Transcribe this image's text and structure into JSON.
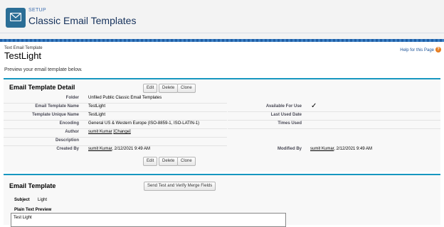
{
  "header": {
    "eyebrow": "SETUP",
    "title": "Classic Email Templates"
  },
  "page": {
    "eyebrow": "Text Email Template",
    "title": "TestLight",
    "help": "Help for this Page",
    "intro": "Preview your email template below."
  },
  "detail": {
    "title": "Email Template Detail",
    "buttons": {
      "edit": "Edit",
      "delete": "Delete",
      "clone": "Clone"
    },
    "folder_label": "Folder",
    "folder_value": "Unfiled Public Classic Email Templates",
    "name_label": "Email Template Name",
    "name_value": "TestLight",
    "available_label": "Available For Use",
    "available_value": "✓",
    "unique_label": "Template Unique Name",
    "unique_value": "TestLight",
    "last_used_label": "Last Used Date",
    "encoding_label": "Encoding",
    "encoding_value": "General US & Western Europe (ISO-8859-1, ISO-LATIN-1)",
    "times_used_label": "Times Used",
    "author_label": "Author",
    "author_name": "sumit Kumar",
    "author_change": "[Change]",
    "description_label": "Description",
    "created_label": "Created By",
    "created_name": "sumit Kumar",
    "created_date": ", 2/12/2021 9:49 AM",
    "modified_label": "Modified By",
    "modified_name": "sumit Kumar",
    "modified_date": ", 2/12/2021 9:49 AM"
  },
  "template": {
    "title": "Email Template",
    "send_button": "Send Test and Verify Merge Fields",
    "subject_label": "Subject",
    "subject_value": "Light",
    "plain_label": "Plain Text Preview",
    "plain_value": "Test Light"
  }
}
